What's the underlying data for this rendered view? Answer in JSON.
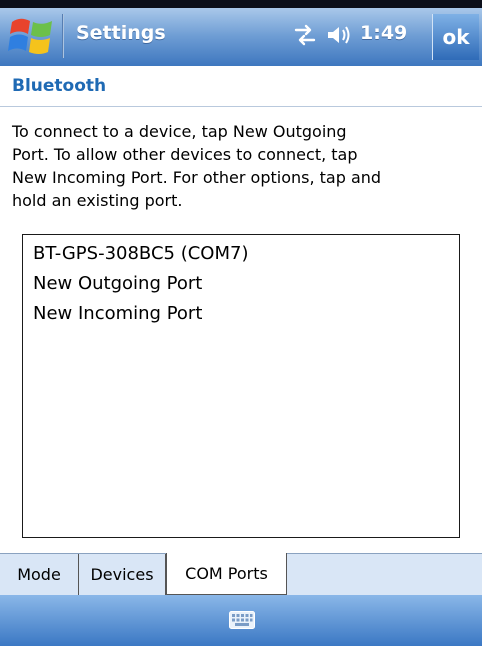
{
  "titlebar": {
    "title": "Settings",
    "clock": "1:49",
    "ok_label": "ok",
    "icons": [
      "windows-start-icon",
      "connectivity-icon",
      "volume-icon"
    ]
  },
  "page": {
    "title": "Bluetooth"
  },
  "instructions": {
    "lines": [
      "To connect to a device, tap New Outgoing",
      "Port. To allow other devices to connect, tap",
      "New Incoming Port. For other options, tap and",
      "hold an existing port."
    ]
  },
  "port_list": {
    "items": [
      "BT-GPS-308BC5 (COM7)",
      "New Outgoing Port",
      "New Incoming Port"
    ]
  },
  "tabs": {
    "items": [
      "Mode",
      "Devices",
      "COM Ports"
    ],
    "active": "COM Ports"
  },
  "menubar": {
    "icons": [
      "keyboard-icon"
    ]
  },
  "colors": {
    "title_bar": "#3e77bf",
    "page_title": "#1f6ab4",
    "tab_strip": "#d9e6f6"
  }
}
